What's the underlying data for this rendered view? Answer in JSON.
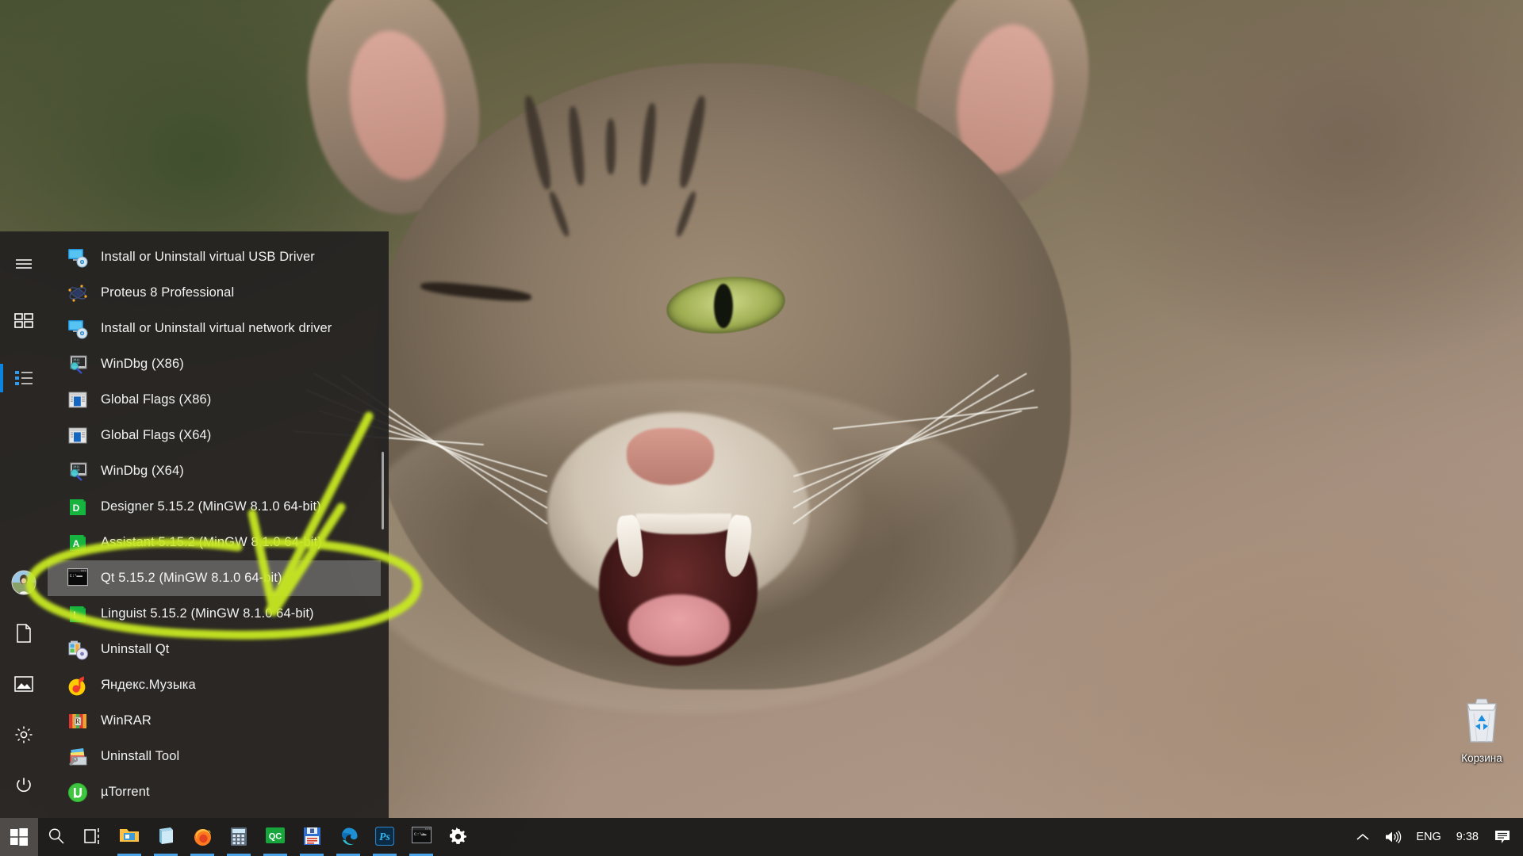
{
  "desktop": {
    "icons": [
      {
        "name": "recycle-bin",
        "label": "Корзина"
      }
    ]
  },
  "start_menu": {
    "rail": [
      {
        "name": "hamburger-menu",
        "label": "Menu",
        "icon": "hamburger-icon",
        "active": false
      },
      {
        "name": "pinned-tiles",
        "label": "Pinned tiles",
        "icon": "tiles-icon",
        "active": false
      },
      {
        "name": "all-apps",
        "label": "All apps",
        "icon": "list-icon",
        "active": true
      },
      {
        "name": "user-account",
        "label": "User",
        "icon": "avatar-icon",
        "active": false
      },
      {
        "name": "documents",
        "label": "Documents",
        "icon": "document-icon",
        "active": false
      },
      {
        "name": "pictures",
        "label": "Pictures",
        "icon": "picture-icon",
        "active": false
      },
      {
        "name": "settings",
        "label": "Settings",
        "icon": "gear-icon",
        "active": false
      },
      {
        "name": "power",
        "label": "Power",
        "icon": "power-icon",
        "active": false
      }
    ],
    "apps": [
      {
        "label": "Install or Uninstall virtual USB Driver",
        "icon": "usb-driver-icon",
        "selected": false
      },
      {
        "label": "Proteus 8 Professional",
        "icon": "proteus-icon",
        "selected": false
      },
      {
        "label": "Install or Uninstall virtual network driver",
        "icon": "network-driver-icon",
        "selected": false
      },
      {
        "label": "WinDbg (X86)",
        "icon": "windbg-icon",
        "selected": false
      },
      {
        "label": "Global Flags (X86)",
        "icon": "global-flags-icon",
        "selected": false
      },
      {
        "label": "Global Flags (X64)",
        "icon": "global-flags-icon",
        "selected": false
      },
      {
        "label": "WinDbg (X64)",
        "icon": "windbg-icon",
        "selected": false
      },
      {
        "label": "Designer 5.15.2 (MinGW 8.1.0 64-bit)",
        "icon": "qt-designer-icon",
        "selected": false
      },
      {
        "label": "Assistant 5.15.2 (MinGW 8.1.0 64-bit)",
        "icon": "qt-assistant-icon",
        "selected": false
      },
      {
        "label": "Qt 5.15.2 (MinGW 8.1.0 64-bit)",
        "icon": "qt-console-icon",
        "selected": true
      },
      {
        "label": "Linguist 5.15.2 (MinGW 8.1.0 64-bit)",
        "icon": "qt-linguist-icon",
        "selected": false
      },
      {
        "label": "Uninstall Qt",
        "icon": "uninstall-qt-icon",
        "selected": false
      },
      {
        "label": "Яндекс.Музыка",
        "icon": "yandex-music-icon",
        "selected": false
      },
      {
        "label": "WinRAR",
        "icon": "winrar-icon",
        "selected": false
      },
      {
        "label": "Uninstall Tool",
        "icon": "uninstall-tool-icon",
        "selected": false
      },
      {
        "label": "µTorrent",
        "icon": "utorrent-icon",
        "selected": false
      }
    ]
  },
  "annotation": {
    "color": "#c7e821",
    "shapes": [
      "ellipse-circle-around-qt-item",
      "arrow-pointing-to-qt-item"
    ]
  },
  "taskbar": {
    "start_button": {
      "name": "start-button",
      "label": "Start"
    },
    "buttons": [
      {
        "name": "search-icon",
        "label": "Search",
        "running": false
      },
      {
        "name": "task-view-icon",
        "label": "Task View",
        "running": false
      },
      {
        "name": "file-explorer-icon",
        "label": "File Explorer",
        "running": true
      },
      {
        "name": "office-word-icon",
        "label": "Word",
        "running": true
      },
      {
        "name": "firefox-icon",
        "label": "Firefox",
        "running": true
      },
      {
        "name": "calculator-icon",
        "label": "Calculator",
        "running": true
      },
      {
        "name": "qc-icon",
        "label": "QC",
        "running": true
      },
      {
        "name": "wordpad-save-icon",
        "label": "WordPad",
        "running": true
      },
      {
        "name": "microsoft-edge-icon",
        "label": "Microsoft Edge",
        "running": true
      },
      {
        "name": "photoshop-icon",
        "label": "Adobe Photoshop",
        "running": true
      },
      {
        "name": "command-prompt-icon",
        "label": "Command Prompt",
        "running": true
      },
      {
        "name": "settings-gear-icon",
        "label": "Settings",
        "running": false
      }
    ],
    "tray": {
      "show_hidden": "show-hidden-icons-chevron",
      "volume": "volume-icon",
      "language": "ENG",
      "clock": "9:38",
      "action_center": "action-center-icon"
    }
  },
  "colors": {
    "menu_bg": "#242221",
    "accent": "#0a84e0",
    "selection": "#919191",
    "highlighter": "#c7e821",
    "taskbar_bg": "#1c1b1a"
  }
}
